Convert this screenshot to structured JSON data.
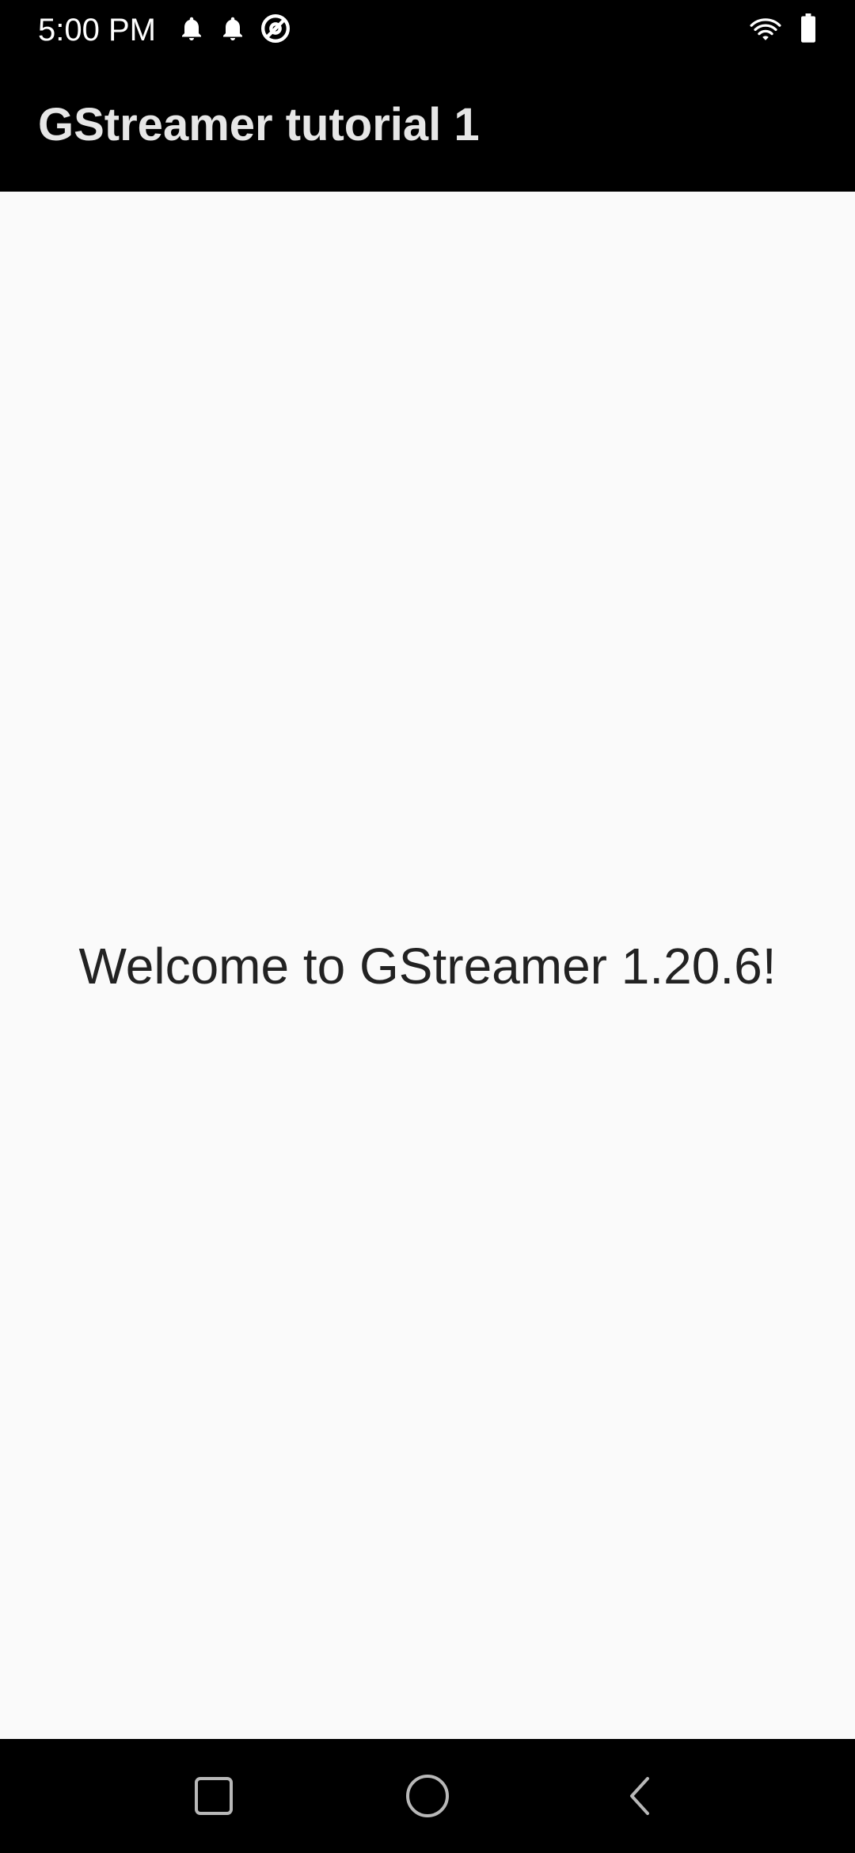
{
  "status_bar": {
    "time": "5:00 PM",
    "left_icons": [
      "notification-bell-icon",
      "notification-bell-icon",
      "at-sign-icon"
    ],
    "right_icons": [
      "wifi-icon",
      "battery-icon"
    ]
  },
  "app_bar": {
    "title": "GStreamer tutorial 1"
  },
  "main": {
    "message": "Welcome to GStreamer 1.20.6!"
  },
  "nav_bar": {
    "buttons": [
      "recents-button",
      "home-button",
      "back-button"
    ]
  },
  "colors": {
    "status_bar_bg": "#000000",
    "app_bar_bg": "#000000",
    "content_bg": "#fafafa",
    "title_color": "#e6e6e6",
    "text_color": "#222222"
  }
}
